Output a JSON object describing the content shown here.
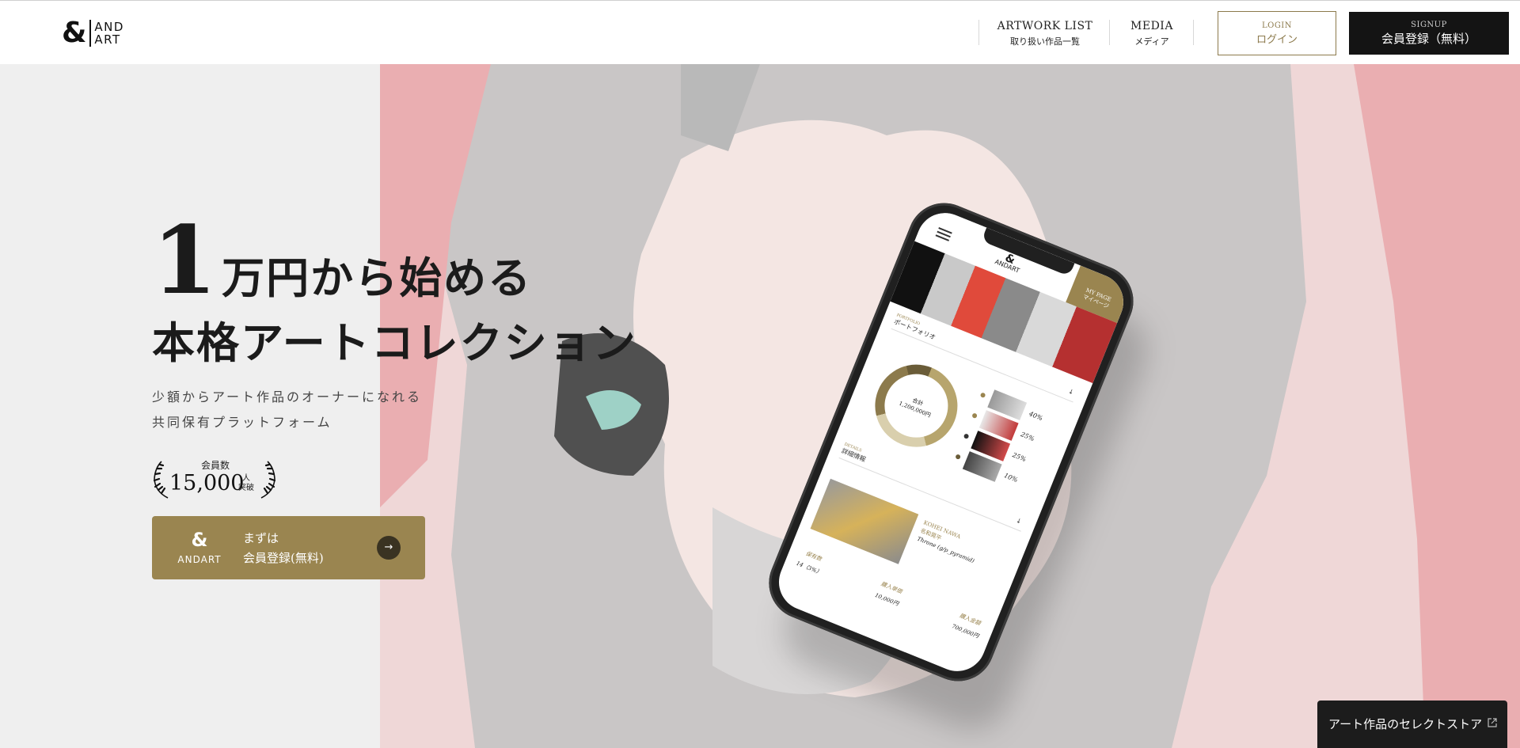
{
  "header": {
    "logo": {
      "amp": "&",
      "line1": "AND",
      "line2": "ART"
    },
    "nav": [
      {
        "en": "ARTWORK LIST",
        "jp": "取り扱い作品一覧"
      },
      {
        "en": "MEDIA",
        "jp": "メディア"
      }
    ],
    "login": {
      "en": "LOGIN",
      "jp": "ログイン"
    },
    "signup": {
      "en": "SIGNUP",
      "jp": "会員登録（無料）"
    }
  },
  "hero": {
    "headline_big": "1",
    "headline_line1": "万円から始める",
    "headline_line2": "本格アートコレクション",
    "subcopy_line1": "少額からアート作品のオーナーになれる",
    "subcopy_line2": "共同保有プラットフォーム",
    "members": {
      "label": "会員数",
      "count": "15,000",
      "unit_line1": "人",
      "unit_line2": "突破"
    },
    "cta": {
      "logo_amp": "&",
      "logo_word": "ANDART",
      "line1": "まずは",
      "line2": "会員登録(無料)",
      "arrow": "→"
    }
  },
  "phone": {
    "logo_amp": "&",
    "logo_word": "ANDART",
    "mypage_en": "MY PAGE",
    "mypage_jp": "マイページ",
    "portfolio_en": "PORTFOLIO",
    "portfolio_jp": "ポートフォリオ",
    "total_label": "合計",
    "total_value": "1,200,000円",
    "allocations": [
      "40%",
      "25%",
      "25%",
      "10%"
    ],
    "details_en": "DETAILS",
    "details_jp": "詳細情報",
    "artist_en": "KOHEI NAWA",
    "artist_jp": "名和晃平",
    "artwork_title": "Throne (g/p_pyramid)",
    "stats": [
      {
        "label": "保有数",
        "value": "14（3%）"
      },
      {
        "label": "購入単価",
        "value": "10,000円"
      },
      {
        "label": "購入金額",
        "value": "700,000円"
      }
    ]
  },
  "select_store": {
    "label": "アート作品のセレクトストア"
  },
  "icons": {
    "arrow": "arrow-right-icon",
    "external": "external-link-icon",
    "laurel": "laurel-icon"
  },
  "colors": {
    "gold": "#9a8550",
    "dark": "#141414",
    "pink": "#efd7d7"
  }
}
